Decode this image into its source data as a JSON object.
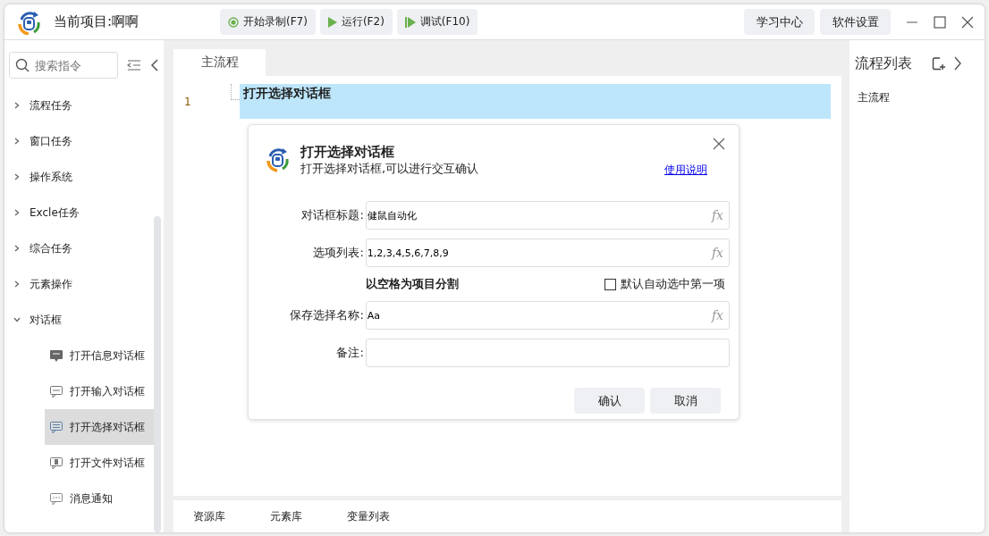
{
  "window": {
    "title": "当前项目:啊啊"
  },
  "toolbar": [
    {
      "label": "开始录制(F7)",
      "kind": "record"
    },
    {
      "label": "运行(F2)",
      "kind": "run"
    },
    {
      "label": "调试(F10)",
      "kind": "debug"
    }
  ],
  "header_buttons": [
    "学习中心",
    "软件设置"
  ],
  "sidebar": {
    "search": {
      "placeholder": "搜索指令"
    },
    "items": [
      {
        "label": "流程任务",
        "expanded": false
      },
      {
        "label": "窗口任务",
        "expanded": false
      },
      {
        "label": "操作系统",
        "expanded": false
      },
      {
        "label": "Excle任务",
        "expanded": false
      },
      {
        "label": "综合任务",
        "expanded": false
      },
      {
        "label": "元素操作",
        "expanded": false
      },
      {
        "label": "对话框",
        "expanded": true,
        "children": [
          {
            "label": "打开信息对话框",
            "kind": "info",
            "selected": false
          },
          {
            "label": "打开输入对话框",
            "kind": "input",
            "selected": false
          },
          {
            "label": "打开选择对话框",
            "kind": "select",
            "selected": true
          },
          {
            "label": "打开文件对话框",
            "kind": "file",
            "selected": false
          },
          {
            "label": "消息通知",
            "kind": "message",
            "selected": false
          }
        ]
      }
    ]
  },
  "editor": {
    "tabs": [
      {
        "label": "主流程",
        "selected": true
      }
    ],
    "lines": [
      {
        "number": "1",
        "text": "打开选择对话框",
        "selected": true
      }
    ]
  },
  "dialog": {
    "title": "打开选择对话框",
    "subtitle": "打开选择对话框,可以进行交互确认",
    "help_link": "使用说明",
    "rows": [
      {
        "kind": "expr",
        "label": "对话框标题:",
        "value": "健鼠自动化",
        "fx": "fx"
      },
      {
        "kind": "expr",
        "label": "选项列表:",
        "value": "1,2,3,4,5,6,7,8,9",
        "fx": "fx"
      },
      {
        "kind": "options",
        "hint": "以空格为项目分割",
        "checkbox": {
          "label": "默认自动选中第一项",
          "checked": false
        }
      },
      {
        "kind": "expr",
        "label": "保存选择名称:",
        "value": "Aa",
        "fx": "fx"
      },
      {
        "kind": "plain",
        "label": "备注:"
      }
    ],
    "buttons": [
      "确认",
      "取消"
    ]
  },
  "bottom_tabs": [
    "资源库",
    "元素库",
    "变量列表"
  ],
  "flow_list": {
    "title": "流程列表",
    "items": [
      "主流程"
    ]
  }
}
